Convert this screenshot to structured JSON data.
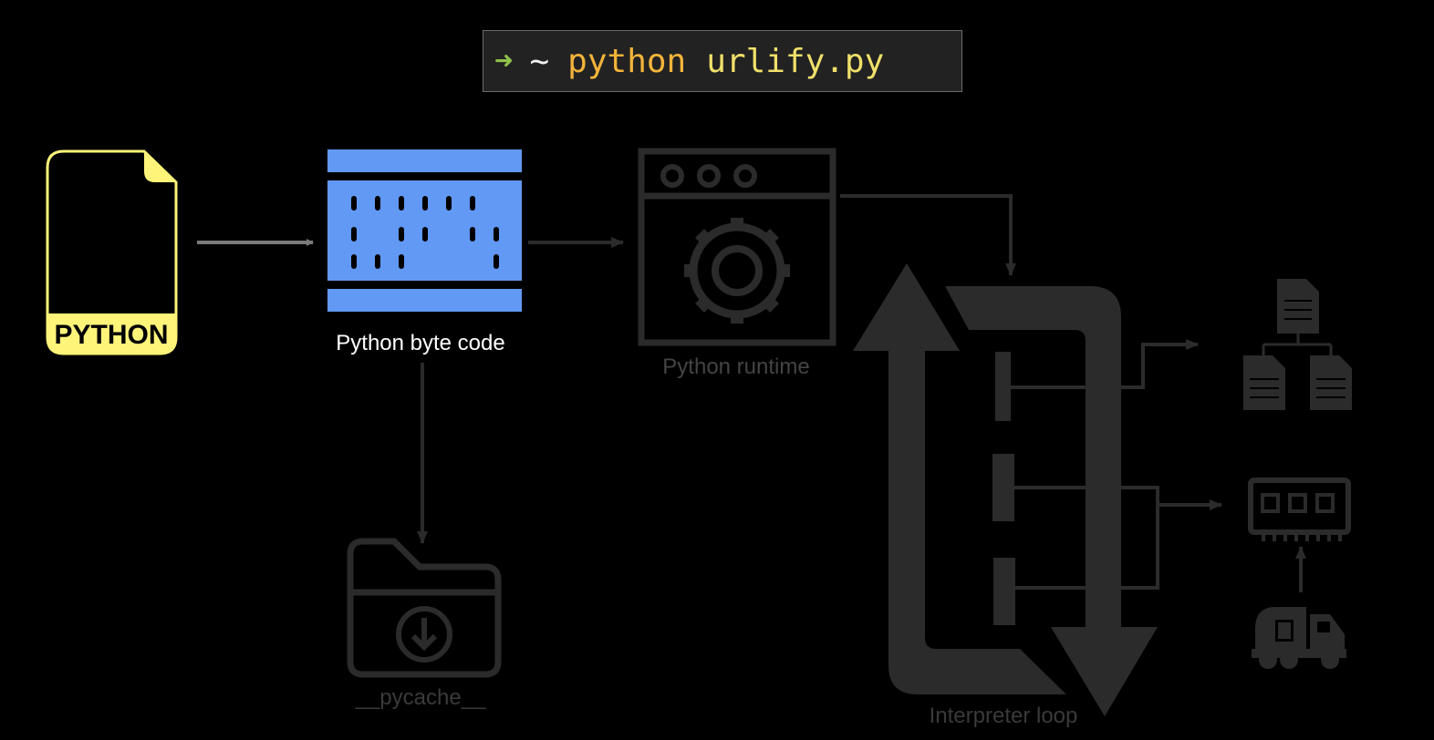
{
  "terminal": {
    "prompt_icon": "right-arrow-icon",
    "arrow": "➜",
    "tilde": "~",
    "command": "python",
    "file": "urlify.py"
  },
  "nodes": {
    "python_file": {
      "badge": "PYTHON",
      "icon": "python-file-icon"
    },
    "bytecode": {
      "label": "Python byte code",
      "icon": "bytecode-icon"
    },
    "runtime": {
      "label": "Python runtime",
      "icon": "gear-window-icon"
    },
    "pycache": {
      "label": "__pycache__",
      "icon": "download-folder-icon"
    },
    "loop": {
      "label": "Interpreter loop",
      "icon": "cycle-arrows-icon"
    },
    "outputs": {
      "documents": "document-hierarchy-icon",
      "memory": "memory-module-icon",
      "truck": "garbage-truck-icon"
    }
  },
  "colors": {
    "background": "#000000",
    "python_yellow": "#fff47a",
    "bytecode_blue": "#6299f5",
    "dim_gray": "#2b2b2b",
    "terminal_bg": "#222222",
    "prompt_green": "#8fc24a",
    "command_orange": "#f2b43a"
  }
}
